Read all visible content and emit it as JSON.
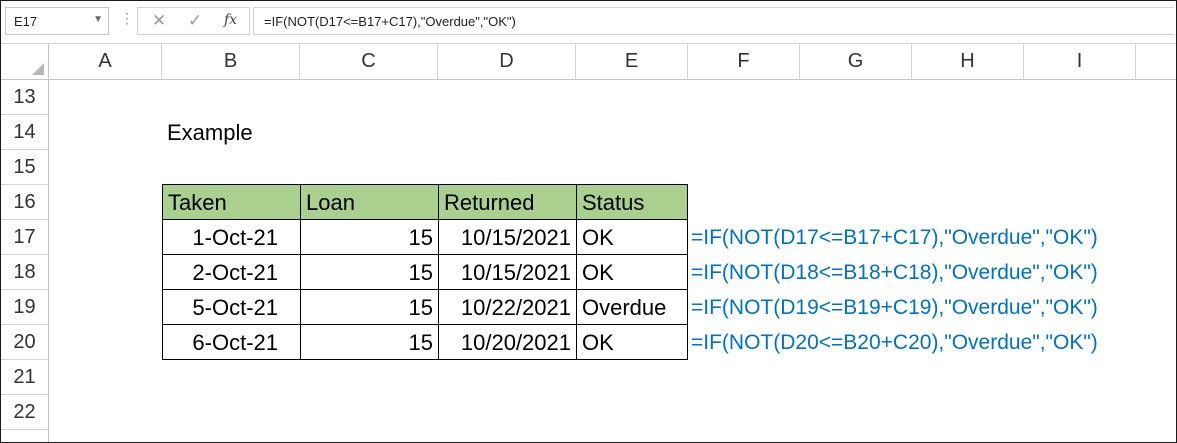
{
  "formula_bar": {
    "name_box": "E17",
    "cancel_icon": "✕",
    "enter_icon": "✓",
    "function_icon": "fx",
    "formula": "=IF(NOT(D17<=B17+C17),\"Overdue\",\"OK\")"
  },
  "columns": [
    "A",
    "B",
    "C",
    "D",
    "E",
    "F",
    "G",
    "H",
    "I"
  ],
  "rows": [
    "13",
    "14",
    "15",
    "16",
    "17",
    "18",
    "19",
    "20",
    "21",
    "22"
  ],
  "cells": {
    "title": "Example"
  },
  "table": {
    "headers": [
      "Taken",
      "Loan",
      "Returned",
      "Status"
    ],
    "rows": [
      [
        "1-Oct-21",
        "15",
        "10/15/2021",
        "OK"
      ],
      [
        "2-Oct-21",
        "15",
        "10/15/2021",
        "OK"
      ],
      [
        "5-Oct-21",
        "15",
        "10/22/2021",
        "Overdue"
      ],
      [
        "6-Oct-21",
        "15",
        "10/20/2021",
        "OK"
      ]
    ],
    "header_color": "#a9d08e"
  },
  "formulas": [
    "=IF(NOT(D17<=B17+C17),\"Overdue\",\"OK\")",
    "=IF(NOT(D18<=B18+C18),\"Overdue\",\"OK\")",
    "=IF(NOT(D19<=B19+C19),\"Overdue\",\"OK\")",
    "=IF(NOT(D20<=B20+C20),\"Overdue\",\"OK\")"
  ],
  "formula_color": "#0070c0"
}
